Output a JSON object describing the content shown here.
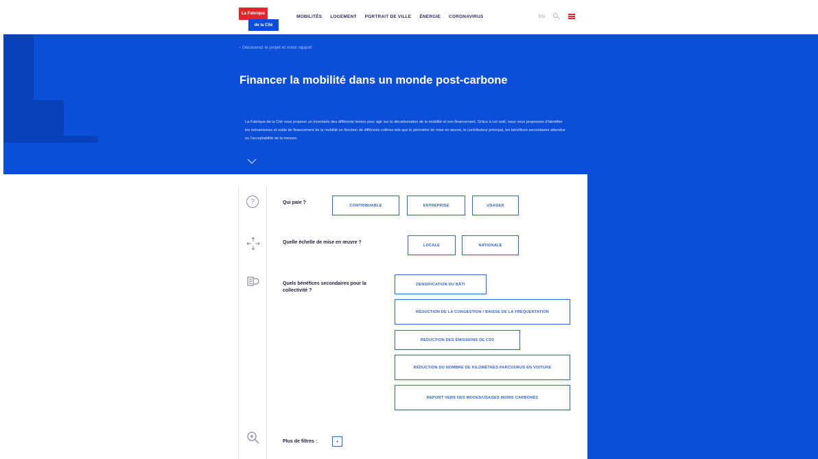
{
  "header": {
    "logo_line1": "La Fabrique",
    "logo_line2": "de la Cité",
    "nav": [
      "MOBILITÉS",
      "LOGEMENT",
      "PORTRAIT DE VILLE",
      "ÉNERGIE",
      "CORONAVIRUS"
    ],
    "lang": "EN",
    "icons": {
      "search": "search-icon",
      "menu": "hamburger-menu-icon"
    }
  },
  "hero": {
    "breadcrumb": "‹ Découvrez le projet et votre rapport",
    "title": "Financer la mobilité dans un monde post-carbone",
    "intro": "La Fabrique de la Cité vous propose un inventaire des différents leviers pour agir sur la décarbonation de la mobilité et son financement. Grâce à cet outil, nous vous proposons d'identifier les mécanismes et outils de financement de la mobilité en fonction de différents critères tels que le périmètre de mise en œuvre, le contributeur principal, les bénéfices secondaires attendus ou l'acceptabilité de la mesure."
  },
  "filters": {
    "payer": {
      "label": "Qui paie ?",
      "options": [
        "CONTRIBUABLE",
        "ENTREPRISE",
        "USAGER"
      ]
    },
    "scale": {
      "label": "Quelle échelle de mise en œuvre ?",
      "options": [
        "LOCALE",
        "NATIONALE"
      ]
    },
    "benefits": {
      "label": "Quels bénéfices secondaires pour la collectivité ?",
      "options": [
        "DENSIFICATION DU BÂTI",
        "RÉDUCTION DE LA CONGESTION / BAISSE DE LA FRÉQUENTATION",
        "RÉDUCTION DES ÉMISSIONS DE CO2",
        "RÉDUCTION DU NOMBRE DE KILOMÈTRES PARCOURUS EN VOITURE",
        "REPORT VERS DES MODES/USAGES MOINS CARBONÉS"
      ]
    },
    "more": {
      "label": "Plus de filtres :",
      "button": "+"
    }
  },
  "colors": {
    "brand_blue": "#0b4ed8",
    "brand_red": "#e4262a",
    "chip_blue": "#2f63d8"
  }
}
